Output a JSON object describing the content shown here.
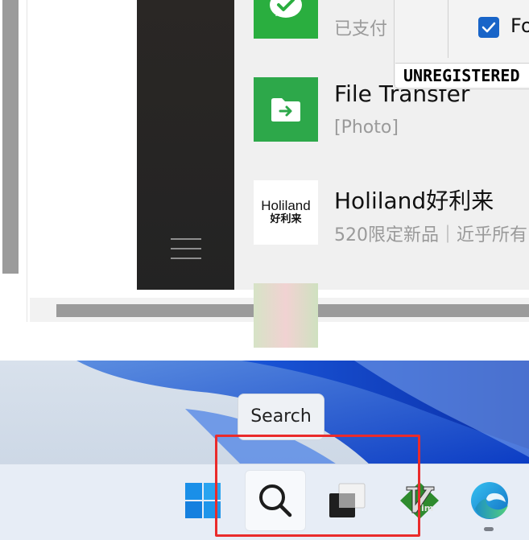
{
  "wechat": {
    "chats": [
      {
        "name": "",
        "preview": "已支付",
        "avatar": "wechat-pay-icon"
      },
      {
        "name": "File Transfer",
        "preview": "[Photo]",
        "avatar": "file-transfer-icon"
      },
      {
        "name": "Holiland好利来",
        "preview": "520限定新品｜近乎所有",
        "avatar_text": {
          "top": "Holiland",
          "bottom": "好利来"
        }
      },
      {
        "name": "",
        "preview": ""
      }
    ]
  },
  "dialog": {
    "checkbox_label": "Fo",
    "checkbox_checked": true,
    "watermark": "UNREGISTERED"
  },
  "taskbar": {
    "tooltip": "Search",
    "items": [
      {
        "name": "Start",
        "icon": "windows-logo-icon"
      },
      {
        "name": "Search",
        "icon": "search-icon"
      },
      {
        "name": "Task View",
        "icon": "task-view-icon"
      },
      {
        "name": "Vim",
        "icon": "vim-icon"
      },
      {
        "name": "Microsoft Edge",
        "icon": "edge-icon"
      }
    ]
  },
  "colors": {
    "highlight": "#ea2b2b",
    "wechat_green": "#2aae3f",
    "checkbox_blue": "#1864c8"
  }
}
